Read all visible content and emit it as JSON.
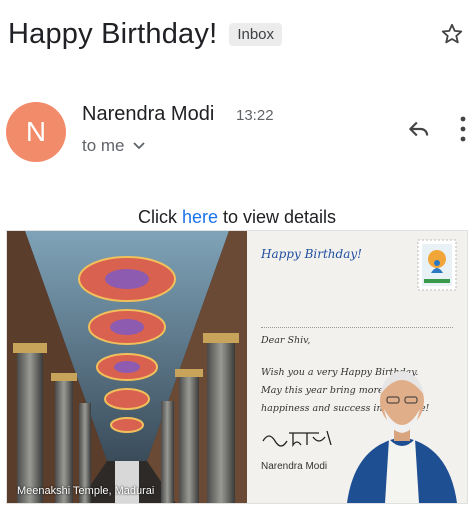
{
  "email": {
    "subject": "Happy Birthday!",
    "label": "Inbox",
    "sender": {
      "initial": "N",
      "name": "Narendra Modi",
      "time": "13:22",
      "to": "to me"
    },
    "body": {
      "click_prefix": "Click ",
      "click_link": "here",
      "click_suffix": " to view details"
    }
  },
  "card": {
    "photo_caption": "Meenakshi Temple, Madurai",
    "greeting": "Happy Birthday!",
    "salutation": "Dear Shiv,",
    "message_lines": [
      "Wish you a very Happy Birthday.",
      "May this year bring more",
      "happiness and success in your life!"
    ],
    "signature_name": "Narendra Modi"
  },
  "colors": {
    "avatar": "#f28b6a",
    "link": "#1a73e8",
    "greeting": "#1f4fa0"
  },
  "icons": [
    "star-icon",
    "reply-icon",
    "more-vert-icon",
    "chevron-down-icon"
  ]
}
